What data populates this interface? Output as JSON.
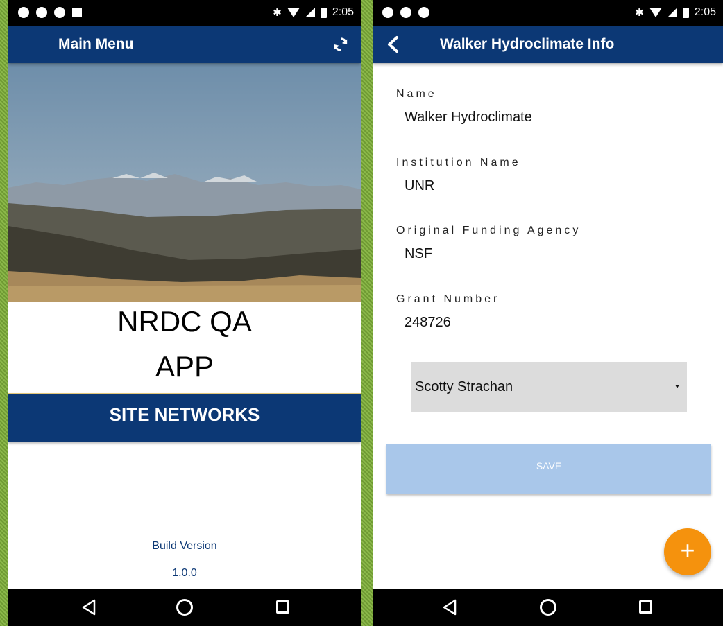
{
  "status_bar": {
    "time": "2:05",
    "bluetooth_icon": "bluetooth-icon",
    "wifi_icon": "wifi-icon",
    "signal_icon": "signal-icon",
    "battery_icon": "battery-icon"
  },
  "main_menu": {
    "title": "Main Menu",
    "refresh_icon": "refresh-icon",
    "app_title_line1": "NRDC QA",
    "app_title_line2": "APP",
    "site_networks_button": "SITE NETWORKS",
    "build_version_label": "Build Version",
    "build_version_value": "1.0.0"
  },
  "info_screen": {
    "title": "Walker Hydroclimate Info",
    "back_icon": "back-arrow-icon",
    "fields": [
      {
        "label": "Name",
        "value": "Walker Hydroclimate"
      },
      {
        "label": "Institution Name",
        "value": "UNR"
      },
      {
        "label": "Original Funding Agency",
        "value": "NSF"
      },
      {
        "label": "Grant Number",
        "value": "248726"
      }
    ],
    "person_dropdown": {
      "selected": "Scotty Strachan"
    },
    "save_button": "SAVE",
    "fab_label": "+",
    "fab_icon": "add-icon"
  },
  "colors": {
    "primary": "#0c3875",
    "save_disabled": "#a9c7ea",
    "fab": "#f5920d",
    "dropdown_bg": "#dcdcdc"
  }
}
